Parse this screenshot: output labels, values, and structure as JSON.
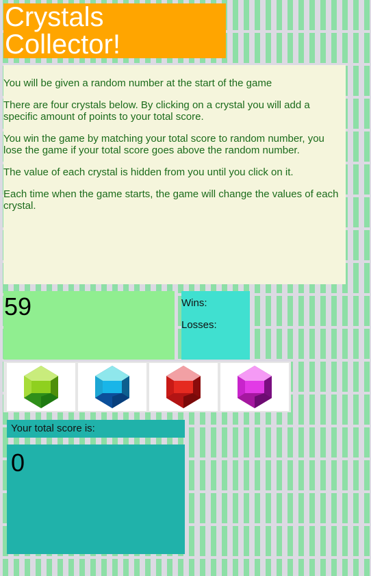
{
  "title": "Crystals Collector!",
  "instructions": [
    "You will be given a random number at the start of the game",
    "There are four crystals below. By clicking on a crystal you will add a specific amount of points to your total score.",
    "You win the game by matching your total score to random number, you lose the game if your total score goes above the random number.",
    "The value of each crystal is hidden from you until you click on it.",
    "Each time when the game starts, the game will change the values of each crystal."
  ],
  "target_number": "59",
  "stats": {
    "wins_label": "Wins:",
    "losses_label": "Losses:"
  },
  "crystals": [
    {
      "name": "green-crystal",
      "color": "#7fc31c"
    },
    {
      "name": "blue-crystal",
      "color": "#1eb4e6"
    },
    {
      "name": "red-crystal",
      "color": "#e0201c"
    },
    {
      "name": "purple-crystal",
      "color": "#d21fd6"
    }
  ],
  "score": {
    "label": "Your total score is:",
    "value": "0"
  },
  "colors": {
    "title_bg": "#ffa500",
    "instructions_bg": "#f5f5dc",
    "instructions_text": "#1b6b1b",
    "target_bg": "#90ee90",
    "stats_bg": "#40e0d0",
    "score_bg": "#20b2aa"
  }
}
